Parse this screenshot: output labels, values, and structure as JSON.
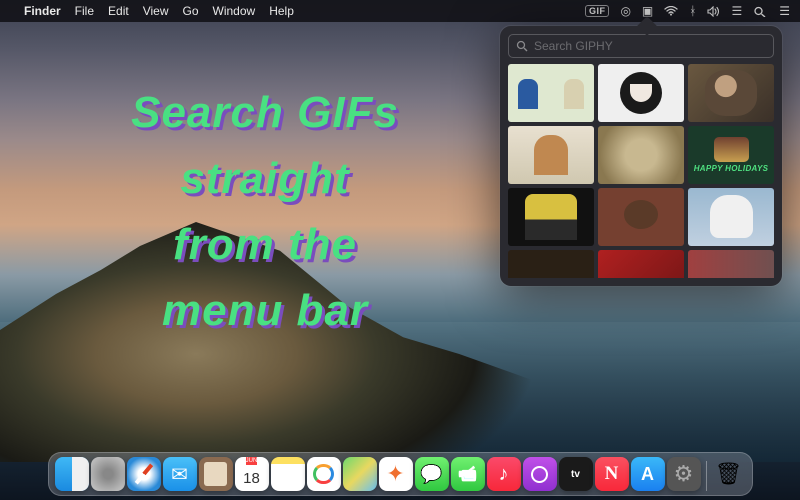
{
  "menubar": {
    "app": "Finder",
    "items": [
      "File",
      "Edit",
      "View",
      "Go",
      "Window",
      "Help"
    ],
    "gif_badge": "GIF"
  },
  "hero": {
    "line1": "Search GIFs",
    "line2": "straight",
    "line3": "from the",
    "line4": "menu bar"
  },
  "popover": {
    "search_placeholder": "Search GIPHY",
    "happy_holidays": "HAPPY HOLIDAYS"
  },
  "calendar": {
    "month": "JUN",
    "day": "18"
  },
  "dock_tv": "tv",
  "colors": {
    "hero_text": "#49e082",
    "hero_shadow": "#7a4dbd",
    "menubar_bg": "rgba(20,20,25,0.92)",
    "popover_bg": "#2a2a30"
  }
}
